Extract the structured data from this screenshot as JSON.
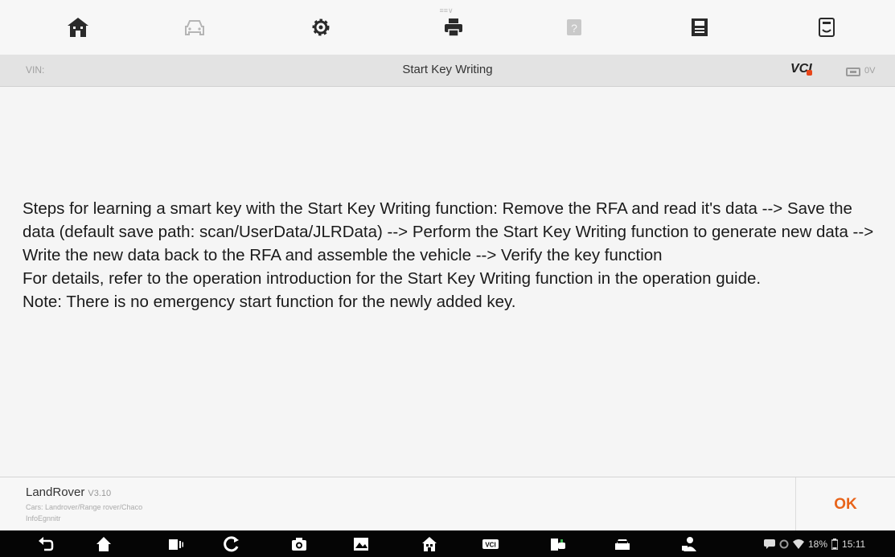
{
  "toolbar": {
    "handle_label": "≡≡∨",
    "buttons": [
      {
        "name": "home-button",
        "icon": "home-icon"
      },
      {
        "name": "vehicle-button",
        "icon": "car-icon"
      },
      {
        "name": "settings-button",
        "icon": "gear-icon"
      },
      {
        "name": "print-button",
        "icon": "printer-icon"
      },
      {
        "name": "help-button",
        "icon": "help-icon"
      },
      {
        "name": "save-button",
        "icon": "save-icon"
      },
      {
        "name": "report-button",
        "icon": "report-icon"
      }
    ]
  },
  "titlebar": {
    "vin_label": "VIN:",
    "title": "Start Key Writing",
    "vci_label": "VCI",
    "voltage": "0V"
  },
  "message": {
    "paragraphs": [
      "Steps for learning a smart key with the Start Key Writing function: Remove the RFA and read it's data --> Save the data (default save path: scan/UserData/JLRData) --> Perform the Start Key Writing function to generate new data --> Write the new data back to the RFA and assemble the vehicle --> Verify the key function",
      "For details, refer to the operation introduction for the Start Key Writing function in the operation guide.",
      "Note: There is no emergency start function for the newly added key."
    ]
  },
  "footer": {
    "vehicle_name": "LandRover",
    "vehicle_version": "V3.10",
    "vehicle_path": "Cars: Landrover/Range rover/Chaco",
    "vehicle_info": "InfoEgnnitr",
    "ok_label": "OK"
  },
  "navbar": {
    "status_text": "18%",
    "clock": "15:11"
  },
  "colors": {
    "accent": "#e8641a",
    "vci_dot": "#e8461a",
    "toolbar_icon": "#2a2a2a",
    "toolbar_icon_disabled": "#b5b5b5",
    "navbar_bg": "#050505"
  }
}
